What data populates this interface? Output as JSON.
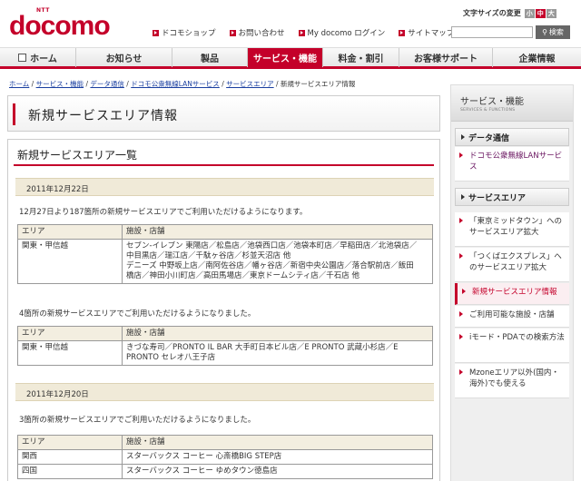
{
  "logo": {
    "ntt": "NTT",
    "name": "docomo"
  },
  "top_links": [
    "ドコモショップ",
    "お問い合わせ",
    "My docomo ログイン",
    "サイトマップ"
  ],
  "font_size": {
    "label": "文字サイズの変更",
    "small": "小",
    "medium": "中",
    "large": "大"
  },
  "search": {
    "button": "検索",
    "value": ""
  },
  "nav": [
    "ホーム",
    "お知らせ",
    "製品",
    "サービス・機能",
    "料金・割引",
    "お客様サポート",
    "企業情報"
  ],
  "breadcrumb": {
    "links": [
      "ホーム",
      "サービス・機能",
      "データ通信",
      "ドコモ公衆無線LANサービス",
      "サービスエリア"
    ],
    "sep": "/",
    "current": "新規サービスエリア情報"
  },
  "page_title": "新規サービスエリア情報",
  "section_title": "新規サービスエリア一覧",
  "headers": {
    "area": "エリア",
    "facility": "施設・店舗"
  },
  "entries": [
    {
      "date": "2011年12月22日",
      "blocks": [
        {
          "intro": "12月27日より187箇所の新規サービスエリアでご利用いただけるようになります。",
          "rows": [
            {
              "area": "関東・甲信越",
              "lines": [
                "セブン-イレブン 東陽店／松島店／池袋西口店／池袋本町店／早稲田店／北池袋店／",
                "中目黒店／瑞江店／千駄ヶ谷店／杉並天沼店 他",
                "デニーズ 中野坂上店／南阿佐谷店／幡ヶ谷店／新宿中央公園店／落合駅前店／飯田",
                "橋店／神田小川町店／高田馬場店／東京ドームシティ店／千石店 他"
              ]
            }
          ]
        },
        {
          "intro": "4箇所の新規サービスエリアでご利用いただけるようになりました。",
          "rows": [
            {
              "area": "関東・甲信越",
              "lines": [
                "きづな寿司／PRONTO IL BAR 大手町日本ビル店／E PRONTO 武蔵小杉店／E",
                "PRONTO セレオ八王子店"
              ]
            }
          ]
        }
      ]
    },
    {
      "date": "2011年12月20日",
      "blocks": [
        {
          "intro": "3箇所の新規サービスエリアでご利用いただけるようになりました。",
          "rows": [
            {
              "area": "関西",
              "lines": [
                "スターバックス コーヒー 心斎橋BIG STEP店"
              ]
            },
            {
              "area": "四国",
              "lines": [
                "スターバックス コーヒー ゆめタウン徳島店"
              ]
            }
          ]
        }
      ]
    }
  ],
  "sidebar": {
    "title": "サービス・機能",
    "subtitle": "SERVICES & FUNCTIONS",
    "cat1": "データ通信",
    "cat1_items": [
      "ドコモ公衆無線LANサービス"
    ],
    "cat2": "サービスエリア",
    "cat2_items": [
      "「東京ミッドタウン」へのサービスエリア拡大",
      "「つくばエクスプレス」へのサービスエリア拡大",
      "新規サービスエリア情報",
      "ご利用可能な施設・店舗",
      "iモード・PDAでの検索方法",
      "Mzoneエリア以外(国内・海外)でも使える"
    ]
  },
  "colors": {
    "brand": "#c4002a",
    "date_bg": "#f0ead8",
    "link": "#1a3fa0"
  }
}
